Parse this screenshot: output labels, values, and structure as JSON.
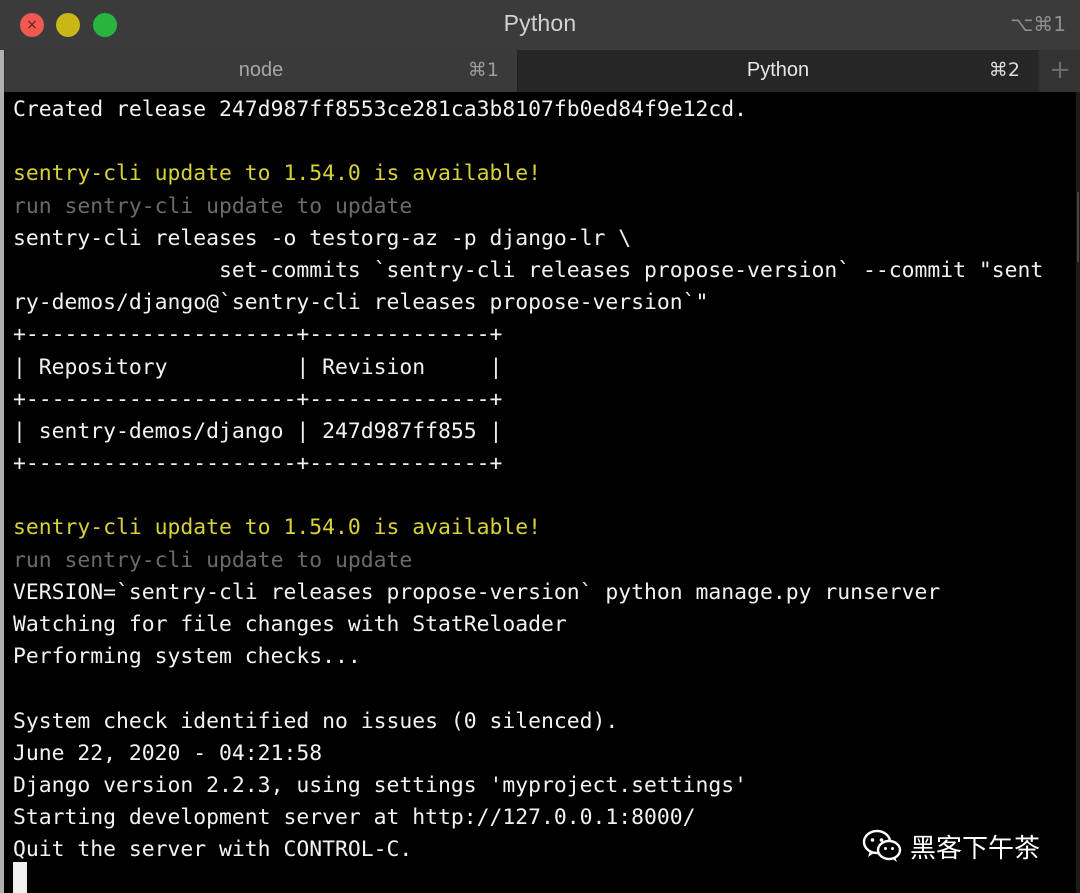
{
  "window": {
    "title": "Python",
    "shortcut": "⌥⌘1"
  },
  "tabs": [
    {
      "label": "node",
      "shortcut": "⌘1",
      "active": false
    },
    {
      "label": "Python",
      "shortcut": "⌘2",
      "active": true
    }
  ],
  "new_tab_symbol": "+",
  "terminal_lines": [
    {
      "text": "Created release 247d987ff8553ce281ca3b8107fb0ed84f9e12cd.",
      "style": "normal"
    },
    {
      "text": "",
      "style": "normal"
    },
    {
      "text": "sentry-cli update to 1.54.0 is available!",
      "style": "warn"
    },
    {
      "text": "run sentry-cli update to update",
      "style": "dim"
    },
    {
      "text": "sentry-cli releases -o testorg-az -p django-lr \\",
      "style": "normal"
    },
    {
      "text": "                set-commits `sentry-cli releases propose-version` --commit \"sent",
      "style": "normal"
    },
    {
      "text": "ry-demos/django@`sentry-cli releases propose-version`\"",
      "style": "normal"
    },
    {
      "text": "+---------------------+--------------+",
      "style": "normal"
    },
    {
      "text": "| Repository          | Revision     |",
      "style": "normal"
    },
    {
      "text": "+---------------------+--------------+",
      "style": "normal"
    },
    {
      "text": "| sentry-demos/django | 247d987ff855 |",
      "style": "normal"
    },
    {
      "text": "+---------------------+--------------+",
      "style": "normal"
    },
    {
      "text": "",
      "style": "normal"
    },
    {
      "text": "sentry-cli update to 1.54.0 is available!",
      "style": "warn"
    },
    {
      "text": "run sentry-cli update to update",
      "style": "dim"
    },
    {
      "text": "VERSION=`sentry-cli releases propose-version` python manage.py runserver",
      "style": "normal"
    },
    {
      "text": "Watching for file changes with StatReloader",
      "style": "normal"
    },
    {
      "text": "Performing system checks...",
      "style": "normal"
    },
    {
      "text": "",
      "style": "normal"
    },
    {
      "text": "System check identified no issues (0 silenced).",
      "style": "normal"
    },
    {
      "text": "June 22, 2020 - 04:21:58",
      "style": "normal"
    },
    {
      "text": "Django version 2.2.3, using settings 'myproject.settings'",
      "style": "normal"
    },
    {
      "text": "Starting development server at http://127.0.0.1:8000/",
      "style": "normal"
    },
    {
      "text": "Quit the server with CONTROL-C.",
      "style": "normal"
    }
  ],
  "watermark": {
    "text": "黑客下午茶",
    "icon": "wechat-icon"
  },
  "colors": {
    "warning_text": "#d8d23a",
    "dim_text": "#6a6a6a",
    "terminal_bg": "#000000",
    "close_button": "#ee5a52",
    "minimize_button": "#c9b718",
    "zoom_button": "#27b540"
  }
}
